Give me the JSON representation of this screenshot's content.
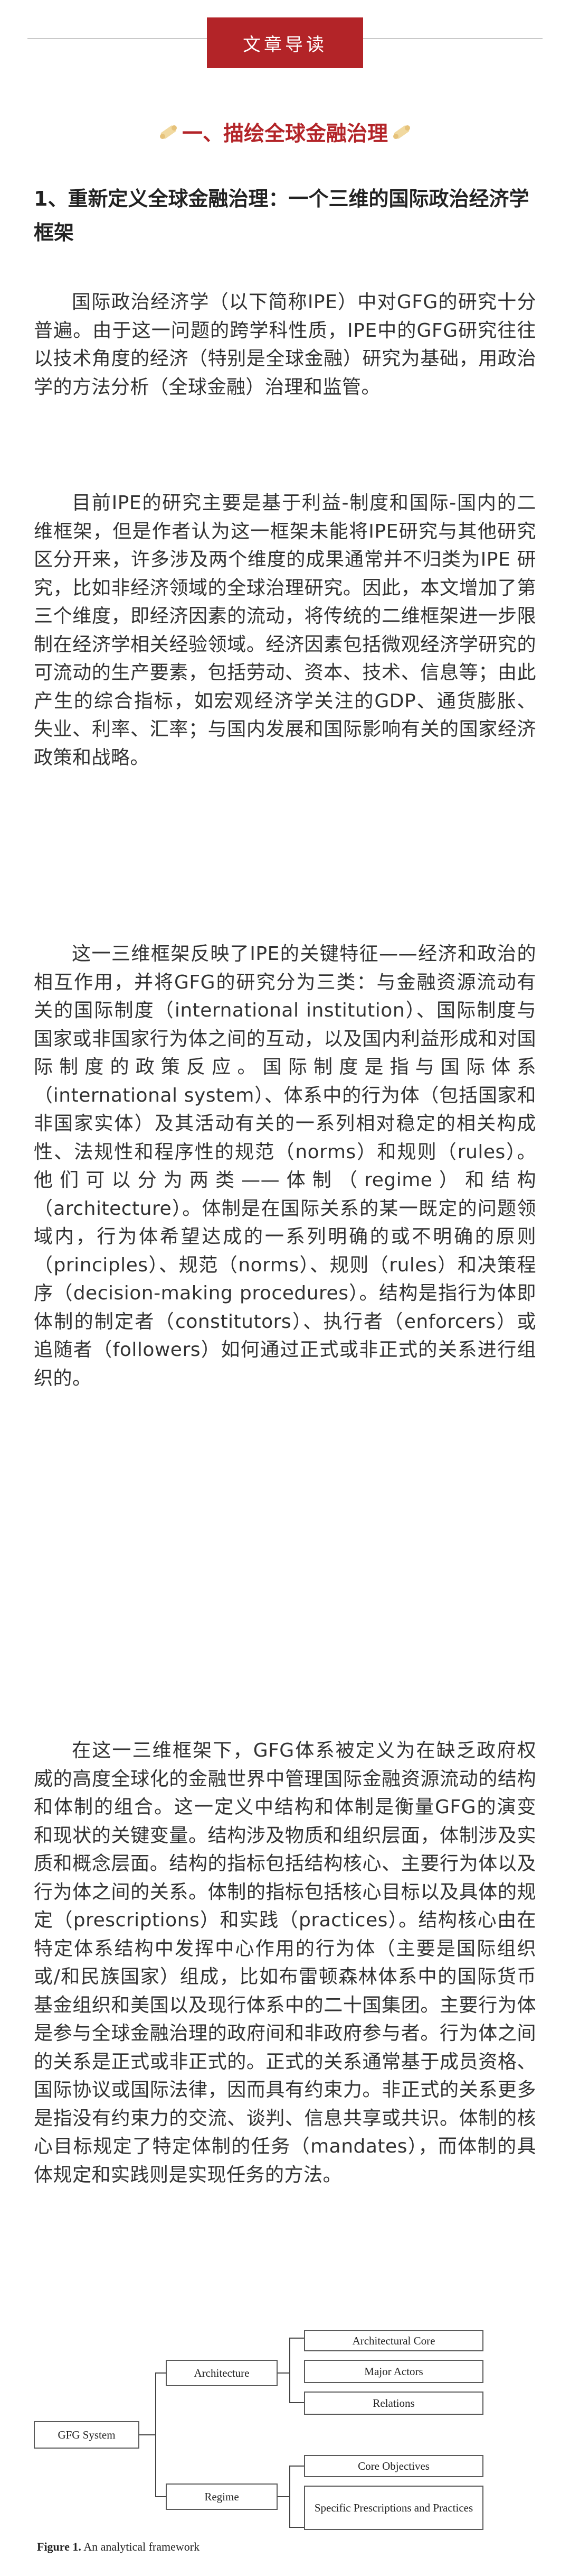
{
  "guide": {
    "label": "文章导读"
  },
  "section": {
    "title": "一、描绘全球金融治理"
  },
  "heading": "1、重新定义全球金融治理：一个三维的国际政治经济学框架",
  "paragraphs": [
    "国际政治经济学（以下简称IPE）中对GFG的研究十分普遍。由于这一问题的跨学科性质，IPE中的GFG研究往往以技术角度的经济（特别是全球金融）研究为基础，用政治学的方法分析（全球金融）治理和监管。",
    "目前IPE的研究主要是基于利益-制度和国际-国内的二维框架，但是作者认为这一框架未能将IPE研究与其他研究区分开来，许多涉及两个维度的成果通常并不归类为IPE 研究，比如非经济领域的全球治理研究。因此，本文增加了第三个维度，即经济因素的流动，将传统的二维框架进一步限制在经济学相关经验领域。经济因素包括微观经济学研究的可流动的生产要素，包括劳动、资本、技术、信息等；由此产生的综合指标，如宏观经济学关注的GDP、通货膨胀、失业、利率、汇率；与国内发展和国际影响有关的国家经济政策和战略。",
    "这一三维框架反映了IPE的关键特征——经济和政治的相互作用，并将GFG的研究分为三类：与金融资源流动有关的国际制度（international institution）、国际制度与国家或非国家行为体之间的互动，以及国内利益形成和对国际制度的政策反应。国际制度是指与国际体系（international system）、体系中的行为体（包括国家和非国家实体）及其活动有关的一系列相对稳定的相关构成性、法规性和程序性的规范（norms）和规则（rules）。他们可以分为两类——体制（regime）和结构（architecture）。体制是在国际关系的某一既定的问题领域内，行为体希望达成的一系列明确的或不明确的原则（principles）、规范（norms）、规则（rules）和决策程序（decision-making procedures）。结构是指行为体即体制的制定者（constitutors）、执行者（enforcers）或追随者（followers）如何通过正式或非正式的关系进行组织的。",
    "在这一三维框架下，GFG体系被定义为在缺乏政府权威的高度全球化的金融世界中管理国际金融资源流动的结构和体制的组合。这一定义中结构和体制是衡量GFG的演变和现状的关键变量。结构涉及物质和组织层面，体制涉及实质和概念层面。结构的指标包括结构核心、主要行为体以及行为体之间的关系。体制的指标包括核心目标以及具体的规定（prescriptions）和实践（practices）。结构核心由在特定体系结构中发挥中心作用的行为体（主要是国际组织或/和民族国家）组成，比如布雷顿森林体系中的国际货币基金组织和美国以及现行体系中的二十国集团。主要行为体是参与全球金融治理的政府间和非政府参与者。行为体之间的关系是正式或非正式的。正式的关系通常基于成员资格、国际协议或国际法律，因而具有约束力。非正式的关系更多是指没有约束力的交流、谈判、信息共享或共识。体制的核心目标规定了特定体制的任务（mandates），而体制的具体规定和实践则是实现任务的方法。"
  ],
  "figure": {
    "root": "GFG System",
    "architecture": "Architecture",
    "regime": "Regime",
    "arch_items": [
      "Architectural Core",
      "Major Actors",
      "Relations"
    ],
    "regime_items": [
      "Core Objectives",
      "Specific Prescriptions and Practices"
    ],
    "caption_label": "Figure 1.",
    "caption_text": " An analytical framework"
  },
  "colors": {
    "accent": "#b32428",
    "rule": "#c9c9c9"
  }
}
